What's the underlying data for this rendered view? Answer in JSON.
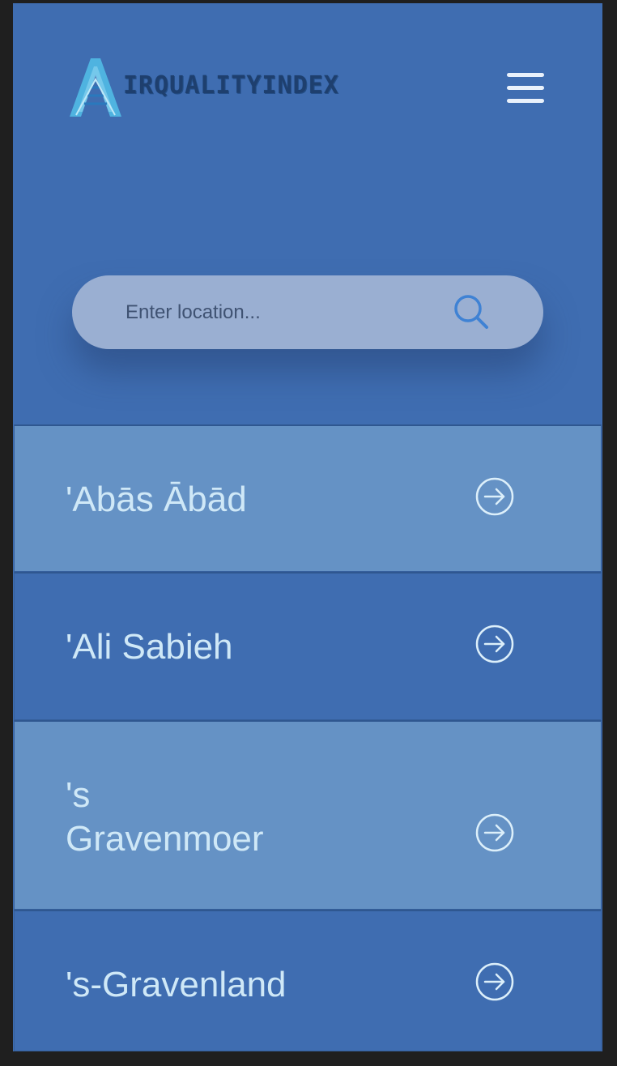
{
  "header": {
    "logo_text": "IRQUALITYINDEX",
    "logo_letter": "A",
    "menu_icon": "hamburger-menu-icon"
  },
  "search": {
    "placeholder": "Enter location...",
    "value": "",
    "icon": "search-icon"
  },
  "locations": [
    {
      "name": "'Abās Ābād",
      "icon": "arrow-right-circle-icon"
    },
    {
      "name": "'Ali Sabieh",
      "icon": "arrow-right-circle-icon"
    },
    {
      "name": "'s Gravenmoer",
      "icon": "arrow-right-circle-icon"
    },
    {
      "name": "'s-Gravenland",
      "icon": "arrow-right-circle-icon"
    }
  ],
  "colors": {
    "background": "#3f6db1",
    "row_light": "#6592c5",
    "row_dark": "#3f6db1",
    "search_bg": "#9aafd2",
    "search_icon": "#3f82d4",
    "text": "#cfe8f7"
  }
}
